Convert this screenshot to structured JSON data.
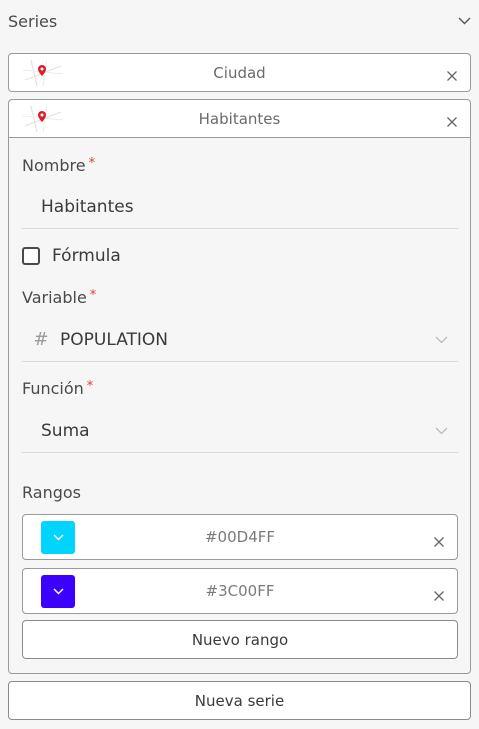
{
  "header": {
    "title": "Series",
    "toggle_icon": "chevron-down-icon"
  },
  "series": [
    {
      "name": "Ciudad",
      "icon": "map-pin-icon"
    },
    {
      "name": "Habitantes",
      "icon": "map-pin-icon"
    }
  ],
  "form": {
    "name_label": "Nombre",
    "name_value": "Habitantes",
    "required_mark": "*",
    "formula_label": "Fórmula",
    "formula_checked": false,
    "variable_label": "Variable",
    "variable_type_icon": "#",
    "variable_value": "POPULATION",
    "function_label": "Función",
    "function_value": "Suma",
    "ranges_label": "Rangos",
    "ranges": [
      {
        "hex": "#00D4FF",
        "color": "#00D4FF"
      },
      {
        "hex": "#3C00FF",
        "color": "#3C00FF"
      }
    ],
    "new_range_label": "Nuevo rango"
  },
  "new_series_label": "Nueva serie",
  "colors": {
    "required": "#e23a3a",
    "border": "#9a9a9a",
    "pin": "#d81f2e"
  }
}
